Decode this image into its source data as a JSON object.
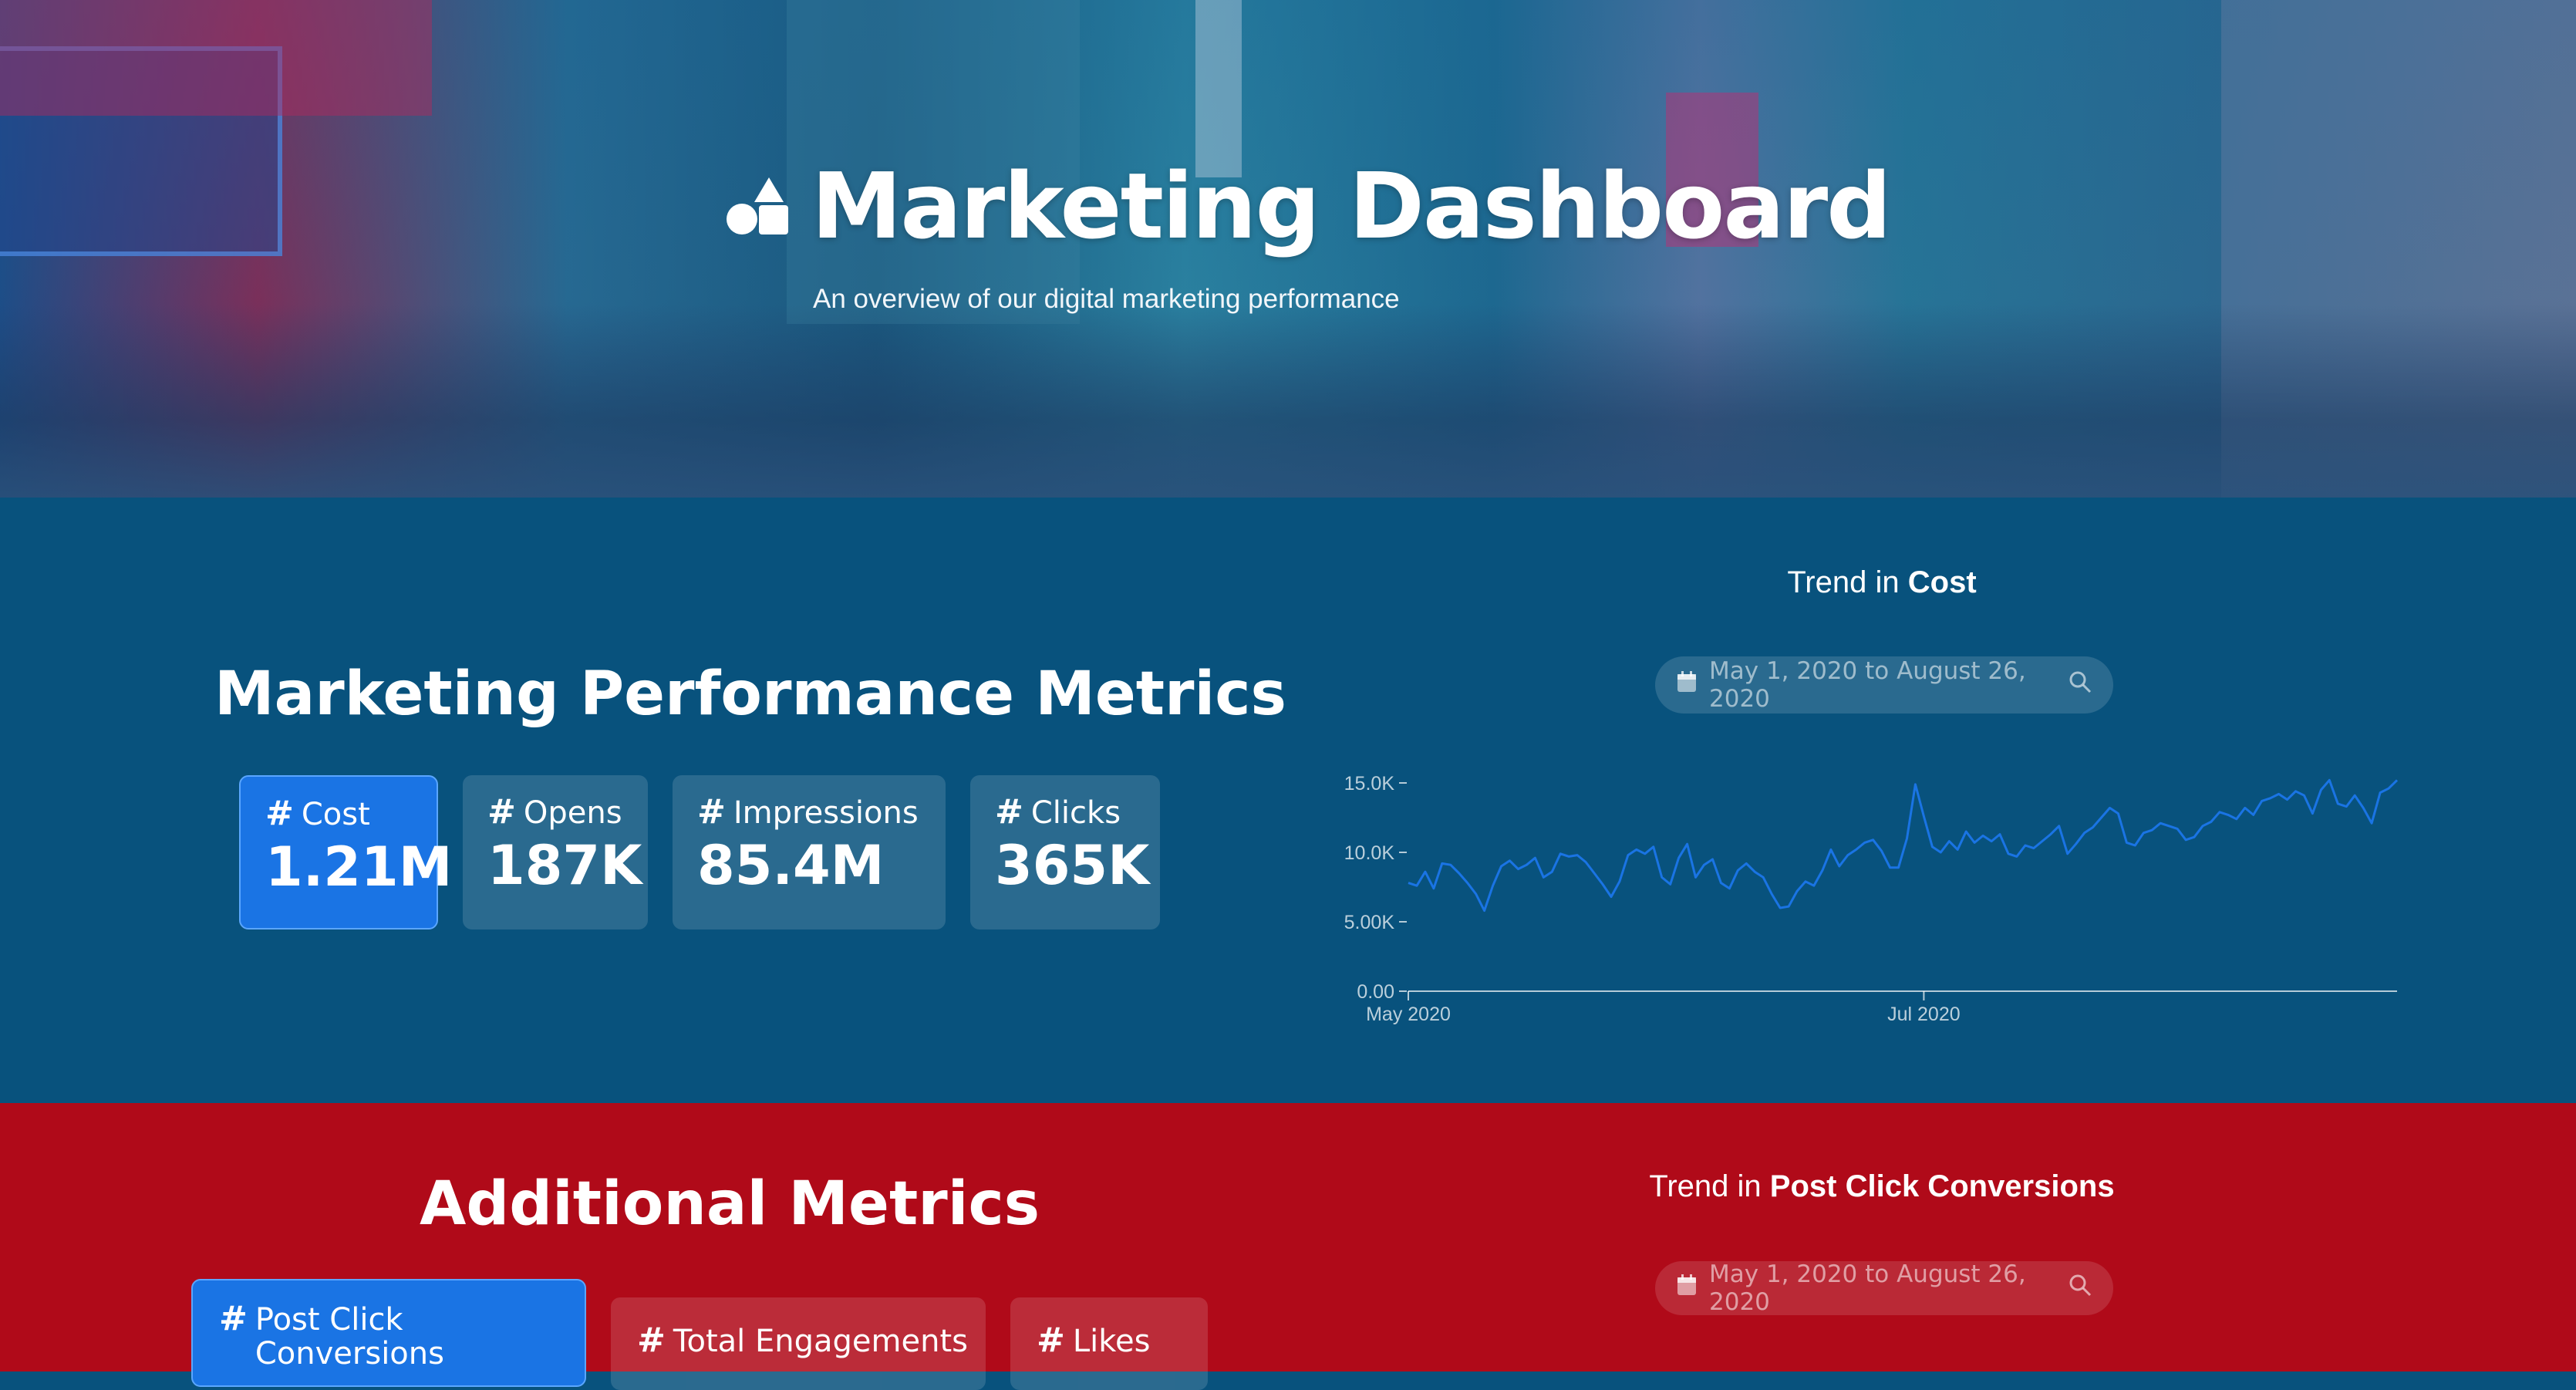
{
  "hero": {
    "title": "Marketing Dashboard",
    "subtitle": "An overview of our digital marketing performance",
    "logo_icon": "shapes-icon"
  },
  "performance": {
    "title": "Marketing Performance Metrics",
    "metrics": [
      {
        "label": "Cost",
        "value": "1.21M",
        "active": true
      },
      {
        "label": "Opens",
        "value": "187K",
        "active": false
      },
      {
        "label": "Impressions",
        "value": "85.4M",
        "active": false
      },
      {
        "label": "Clicks",
        "value": "365K",
        "active": false
      }
    ],
    "trend_prefix": "Trend in",
    "trend_metric": "Cost",
    "date_range": "May 1, 2020 to August 26, 2020"
  },
  "additional": {
    "title": "Additional Metrics",
    "metrics": [
      {
        "label": "Post Click Conversions",
        "active": true
      },
      {
        "label": "Total Engagements",
        "active": false
      },
      {
        "label": "Likes",
        "active": false
      }
    ],
    "trend_prefix": "Trend in",
    "trend_metric": "Post Click Conversions",
    "date_range": "May 1, 2020 to August 26, 2020"
  },
  "colors": {
    "section_blue": "#08527d",
    "section_red": "#b00a19",
    "accent": "#1a74e4",
    "line": "#1a74e4"
  },
  "chart_data": {
    "type": "line",
    "title": "",
    "xlabel": "",
    "ylabel": "",
    "ylim": [
      0,
      15000
    ],
    "yticks": [
      "0.00",
      "5.00K",
      "10.0K",
      "15.0K"
    ],
    "xticks": [
      "May 2020",
      "Jul 2020"
    ],
    "x_start": "2020-05-01",
    "x_end": "2020-08-26",
    "series": [
      {
        "values": [
          7800,
          7600,
          8600,
          7400,
          9200,
          9100,
          8500,
          7800,
          7000,
          5800,
          7600,
          9000,
          9400,
          8800,
          9100,
          9600,
          8200,
          8600,
          9900,
          9700,
          9800,
          9300,
          8500,
          7700,
          6800,
          7900,
          9800,
          10200,
          9900,
          10400,
          8200,
          7700,
          9600,
          10600,
          8200,
          9100,
          9500,
          7800,
          7400,
          8700,
          9200,
          8600,
          8200,
          7000,
          6000,
          6100,
          7200,
          7900,
          7600,
          8700,
          10200,
          9000,
          9800,
          10200,
          10700,
          10900,
          10100,
          8900,
          8900,
          11000,
          14900,
          12600,
          10400,
          10000,
          10800,
          10200,
          11500,
          10700,
          11200,
          10800,
          11300,
          9900,
          9700,
          10500,
          10300,
          10800,
          11300,
          11900,
          9900,
          10600,
          11400,
          11800,
          12500,
          13200,
          12800,
          10700,
          10500,
          11400,
          11600,
          12100,
          11900,
          11700,
          10900,
          11100,
          11900,
          12200,
          12900,
          12700,
          12400,
          13200,
          12700,
          13700,
          13900,
          14200,
          13800,
          14400,
          14100,
          12800,
          14500,
          15200,
          13500,
          13300,
          14100,
          13200,
          12100,
          14300,
          14600,
          15200
        ]
      }
    ]
  }
}
